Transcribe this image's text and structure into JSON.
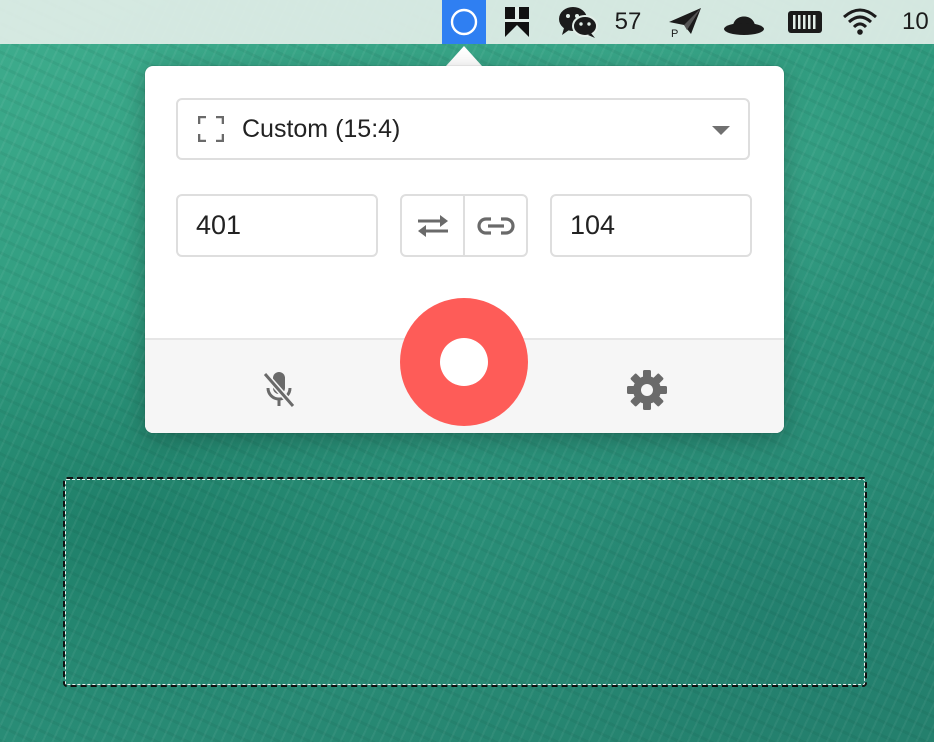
{
  "menubar": {
    "wechat_count": "57",
    "battery_percent_partial": "10",
    "icons": [
      "recorder-app-icon",
      "bookmark-app-icon",
      "wechat-icon",
      "paper-plane-icon",
      "hat-icon",
      "battery-icon",
      "wifi-icon"
    ],
    "active_color": "#2f7ff2"
  },
  "popover": {
    "preset": {
      "label": "Custom (15:4)",
      "icon": "fullscreen-frame-icon"
    },
    "width_value": "401",
    "height_value": "104",
    "swap_icon": "swap-arrows-icon",
    "link_icon": "link-icon",
    "mic_icon": "mic-off-icon",
    "settings_icon": "gear-icon",
    "record_color": "#fe5c58"
  }
}
